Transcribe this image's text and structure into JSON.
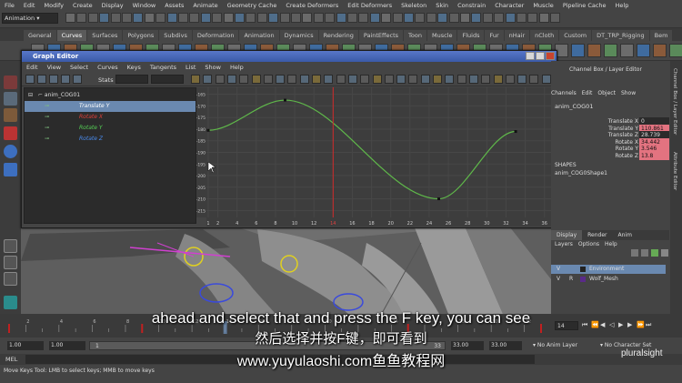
{
  "menubar": [
    "File",
    "Edit",
    "Modify",
    "Create",
    "Display",
    "Window",
    "Assets",
    "Animate",
    "Geometry Cache",
    "Create Deformers",
    "Edit Deformers",
    "Skeleton",
    "Skin",
    "Constrain",
    "Character",
    "Muscle",
    "Pipeline Cache",
    "Help"
  ],
  "mode_selector": "Animation",
  "shelf_tabs": [
    "General",
    "Curves",
    "Surfaces",
    "Polygons",
    "Subdivs",
    "Deformation",
    "Animation",
    "Dynamics",
    "Rendering",
    "PaintEffects",
    "Toon",
    "Muscle",
    "Fluids",
    "Fur",
    "nHair",
    "nCloth",
    "Custom",
    "DT_TRP_Rigging",
    "Bem"
  ],
  "shelf_active": "Curves",
  "graph_editor": {
    "title": "Graph Editor",
    "menu": [
      "Edit",
      "View",
      "Select",
      "Curves",
      "Keys",
      "Tangents",
      "List",
      "Show",
      "Help"
    ],
    "stats_label": "Stats",
    "outliner": {
      "root": "anim_COG01",
      "channels": [
        {
          "label": "Translate Y",
          "selected": true,
          "color": "#e8e8e8"
        },
        {
          "label": "Rotate X",
          "selected": false,
          "color": "#e0403a"
        },
        {
          "label": "Rotate Y",
          "selected": false,
          "color": "#55d055"
        },
        {
          "label": "Rotate Z",
          "selected": false,
          "color": "#4a8cf0"
        }
      ]
    },
    "y_ticks": [
      "-165",
      "-170",
      "-175",
      "-180",
      "-185",
      "-190",
      "-195",
      "-200",
      "-205",
      "-210",
      "-215"
    ],
    "x_ticks": [
      "1",
      "2",
      "4",
      "6",
      "8",
      "10",
      "12",
      "14",
      "16",
      "18",
      "20",
      "22",
      "24",
      "26",
      "28",
      "30",
      "32",
      "34",
      "36"
    ],
    "current_frame": 14,
    "curve_keys": [
      {
        "frame": 1,
        "value": -180.5
      },
      {
        "frame": 9,
        "value": -167.5
      },
      {
        "frame": 25,
        "value": -210
      },
      {
        "frame": 33,
        "value": -181
      }
    ],
    "curve_color": "#5fb84a"
  },
  "channel_box": {
    "header": "Channel Box / Layer Editor",
    "menu": [
      "Channels",
      "Edit",
      "Object",
      "Show"
    ],
    "object": "anim_COG01",
    "attributes": [
      {
        "name": "Translate X",
        "value": "0",
        "keyed": false
      },
      {
        "name": "Translate Y",
        "value": "110.861",
        "keyed": true
      },
      {
        "name": "Translate Z",
        "value": "28.739",
        "keyed": false
      },
      {
        "name": "Rotate X",
        "value": "34.442",
        "keyed": true
      },
      {
        "name": "Rotate Y",
        "value": "3.546",
        "keyed": true
      },
      {
        "name": "Rotate Z",
        "value": "13.8",
        "keyed": true
      }
    ],
    "shapes_label": "SHAPES",
    "shape": "anim_COG0Shape1"
  },
  "layer_editor": {
    "tabs": [
      "Display",
      "Render",
      "Anim"
    ],
    "menu": [
      "Layers",
      "Options",
      "Help"
    ],
    "layers": [
      {
        "v": "V",
        "flag": "",
        "name": "Environment",
        "selected": true
      },
      {
        "v": "V",
        "flag": "R",
        "name": "Wolf_Mesh",
        "selected": false
      }
    ]
  },
  "right_strip_labels": [
    "Channel Box / Layer Editor",
    "Attribute Editor"
  ],
  "timeline": {
    "ticks": [
      "2",
      "4",
      "6",
      "8",
      "10",
      "12",
      "14",
      "16",
      "18",
      "20",
      "22",
      "24",
      "26",
      "28",
      "30",
      "32"
    ],
    "current": "14"
  },
  "range": {
    "start": "1.00",
    "start2": "1.00",
    "inner": "1",
    "end": "33",
    "end_inner": "33.00",
    "end2": "33.00",
    "anim_layer": "No Anim Layer",
    "character": "No Character Set"
  },
  "mel_label": "MEL",
  "help_line": "Move Keys Tool: LMB to select keys; MMB to move keys",
  "watermark": "pluralsight",
  "subtitles": {
    "line1": "ahead and select that and press the F key, you can see",
    "line2": "然后选择并按F键，即可看到",
    "line3": "www.yuyulaoshi.com鱼鱼教程网"
  }
}
